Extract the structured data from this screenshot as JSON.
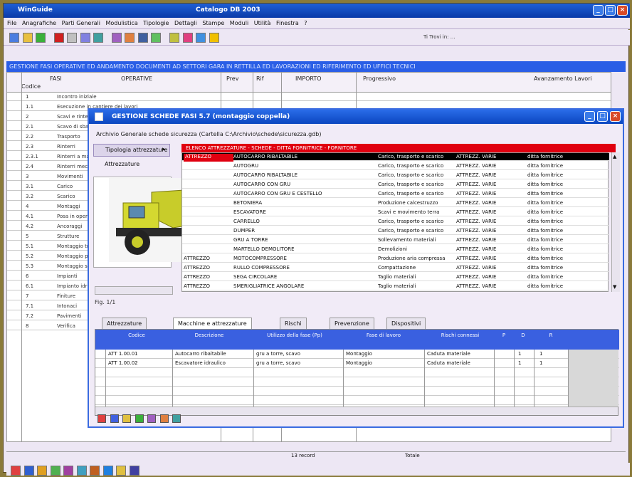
{
  "app": {
    "title": "WinGuide",
    "doc": "Catalogo DB 2003"
  },
  "menu": [
    "File",
    "Anagrafiche",
    "Parti Generali",
    "Modulistica",
    "Tipologie",
    "Dettagli",
    "Stampe",
    "Moduli",
    "Utilità",
    "Finestra",
    "?"
  ],
  "toolbar_status": "Ti Trovi in: ...",
  "blue_bar": "GESTIONE FASI OPERATIVE ED ANDAMENTO DOCUMENTI AD SETTORI GARA IN RETTILLA ED LAVORAZIONI ED RIFERIMENTO ED UFFICI TECNICI",
  "bg_headers": {
    "fasi": "FASI",
    "codice": "Codice",
    "operative": "OPERATIVE",
    "prev": "Prev",
    "rif": "Rif",
    "importo": "IMPORTO",
    "col6": "Progressivo",
    "col7": "Avanzamento Lavori"
  },
  "bg_rows": [
    {
      "code": "1",
      "op": "Incontro iniziale"
    },
    {
      "code": "1.1",
      "op": "Esecuzione in cantiere dei lavori"
    },
    {
      "code": "2",
      "op": "Scavi e rinterri"
    },
    {
      "code": "2.1",
      "op": "Scavo di sbancamento"
    },
    {
      "code": "2.2",
      "op": "Trasporto"
    },
    {
      "code": "2.3",
      "op": "Rinterri"
    },
    {
      "code": "2.3.1",
      "op": "Rinterri a mano"
    },
    {
      "code": "2.4",
      "op": "Rinterri meccanici"
    },
    {
      "code": "3",
      "op": "Movimenti"
    },
    {
      "code": "3.1",
      "op": "Carico"
    },
    {
      "code": "3.2",
      "op": "Scarico"
    },
    {
      "code": "4",
      "op": "Montaggi"
    },
    {
      "code": "4.1",
      "op": "Posa in opera"
    },
    {
      "code": "4.2",
      "op": "Ancoraggi"
    },
    {
      "code": "5",
      "op": "Strutture"
    },
    {
      "code": "5.1",
      "op": "Montaggio travi"
    },
    {
      "code": "5.2",
      "op": "Montaggio pilastri"
    },
    {
      "code": "5.3",
      "op": "Montaggio solai"
    },
    {
      "code": "6",
      "op": "Impianti"
    },
    {
      "code": "6.1",
      "op": "Impianto idrico"
    },
    {
      "code": "7",
      "op": "Finiture"
    },
    {
      "code": "7.1",
      "op": "Intonaci"
    },
    {
      "code": "7.2",
      "op": "Pavimenti"
    },
    {
      "code": "8",
      "op": "Verifica"
    }
  ],
  "dialog": {
    "title": "GESTIONE SCHEDE FASI 5.7 (montaggio coppella)",
    "path": "Archivio Generale schede sicurezza (Cartella C:\\Archivio\\schede\\sicurezza.gdb)",
    "section": "Tipologia attrezzature",
    "section_sub": "Attrezzature",
    "list_header": "ELENCO ATTREZZATURE - SCHEDE - DITTA FORNITRICE - FORNITORE",
    "rows": [
      {
        "c1": "ATTREZZO",
        "c2": "AUTOCARRO RIBALTABILE",
        "c3": "Carico, trasporto e scarico",
        "c4": "ATTREZZ. VARIE",
        "c5": "ditta fornitrice"
      },
      {
        "c1": "",
        "c2": "AUTOGRU",
        "c3": "Carico, trasporto e scarico",
        "c4": "ATTREZZ. VARIE",
        "c5": "ditta fornitrice"
      },
      {
        "c1": "",
        "c2": "AUTOCARRO RIBALTABILE",
        "c3": "Carico, trasporto e scarico",
        "c4": "ATTREZZ. VARIE",
        "c5": "ditta fornitrice"
      },
      {
        "c1": "",
        "c2": "AUTOCARRO CON GRU",
        "c3": "Carico, trasporto e scarico",
        "c4": "ATTREZZ. VARIE",
        "c5": "ditta fornitrice"
      },
      {
        "c1": "",
        "c2": "AUTOCARRO CON GRU E CESTELLO",
        "c3": "Carico, trasporto e scarico",
        "c4": "ATTREZZ. VARIE",
        "c5": "ditta fornitrice"
      },
      {
        "c1": "",
        "c2": "BETONIERA",
        "c3": "Produzione calcestruzzo",
        "c4": "ATTREZZ. VARIE",
        "c5": "ditta fornitrice"
      },
      {
        "c1": "",
        "c2": "ESCAVATORE",
        "c3": "Scavi e movimento terra",
        "c4": "ATTREZZ. VARIE",
        "c5": "ditta fornitrice"
      },
      {
        "c1": "",
        "c2": "CARRELLO",
        "c3": "Carico, trasporto e scarico",
        "c4": "ATTREZZ. VARIE",
        "c5": "ditta fornitrice"
      },
      {
        "c1": "",
        "c2": "DUMPER",
        "c3": "Carico, trasporto e scarico",
        "c4": "ATTREZZ. VARIE",
        "c5": "ditta fornitrice"
      },
      {
        "c1": "",
        "c2": "GRU A TORRE",
        "c3": "Sollevamento materiali",
        "c4": "ATTREZZ. VARIE",
        "c5": "ditta fornitrice"
      },
      {
        "c1": "",
        "c2": "MARTELLO DEMOLITORE",
        "c3": "Demolizioni",
        "c4": "ATTREZZ. VARIE",
        "c5": "ditta fornitrice"
      },
      {
        "c1": "ATTREZZO",
        "c2": "MOTOCOMPRESSORE",
        "c3": "Produzione aria compressa",
        "c4": "ATTREZZ. VARIE",
        "c5": "ditta fornitrice"
      },
      {
        "c1": "ATTREZZO",
        "c2": "RULLO COMPRESSORE",
        "c3": "Compattazione",
        "c4": "ATTREZZ. VARIE",
        "c5": "ditta fornitrice"
      },
      {
        "c1": "ATTREZZO",
        "c2": "SEGA CIRCOLARE",
        "c3": "Taglio materiali",
        "c4": "ATTREZZ. VARIE",
        "c5": "ditta fornitrice"
      },
      {
        "c1": "ATTREZZO",
        "c2": "SMERIGLIATRICE ANGOLARE",
        "c3": "Taglio materiali",
        "c4": "ATTREZZ. VARIE",
        "c5": "ditta fornitrice"
      }
    ],
    "thumb_caption": "Fig. 1/1",
    "tabs": [
      "Attrezzature",
      "Macchine e attrezzature",
      "Rischi",
      "Prevenzione",
      "Dispositivi"
    ],
    "grid_headers": [
      "Codice",
      "Descrizione",
      "Utilizzo della fase (Pp)",
      "Fase di lavoro",
      "Rischi connessi",
      "P",
      "D",
      "R"
    ],
    "grid_rows": [
      {
        "c0": "ATT 1.00.01",
        "c1": "Autocarro ribaltabile",
        "c2": "gru a torre, scavo",
        "c3": "Montaggio",
        "c4": "Caduta materiale",
        "c5": "",
        "c6": "1",
        "c7": "1"
      },
      {
        "c0": "ATT 1.00.02",
        "c1": "Escavatore idraulico",
        "c2": "gru a torre, scavo",
        "c3": "Montaggio",
        "c4": "Caduta materiale",
        "c5": "",
        "c6": "1",
        "c7": "1"
      }
    ]
  },
  "status": {
    "left": "",
    "mid": "13 record",
    "right": "Totale"
  },
  "colors": {
    "title_blue": "#0a3aa8",
    "red": "#e00010",
    "grid_head": "#3a60e0",
    "frame": "#ede7f4"
  }
}
